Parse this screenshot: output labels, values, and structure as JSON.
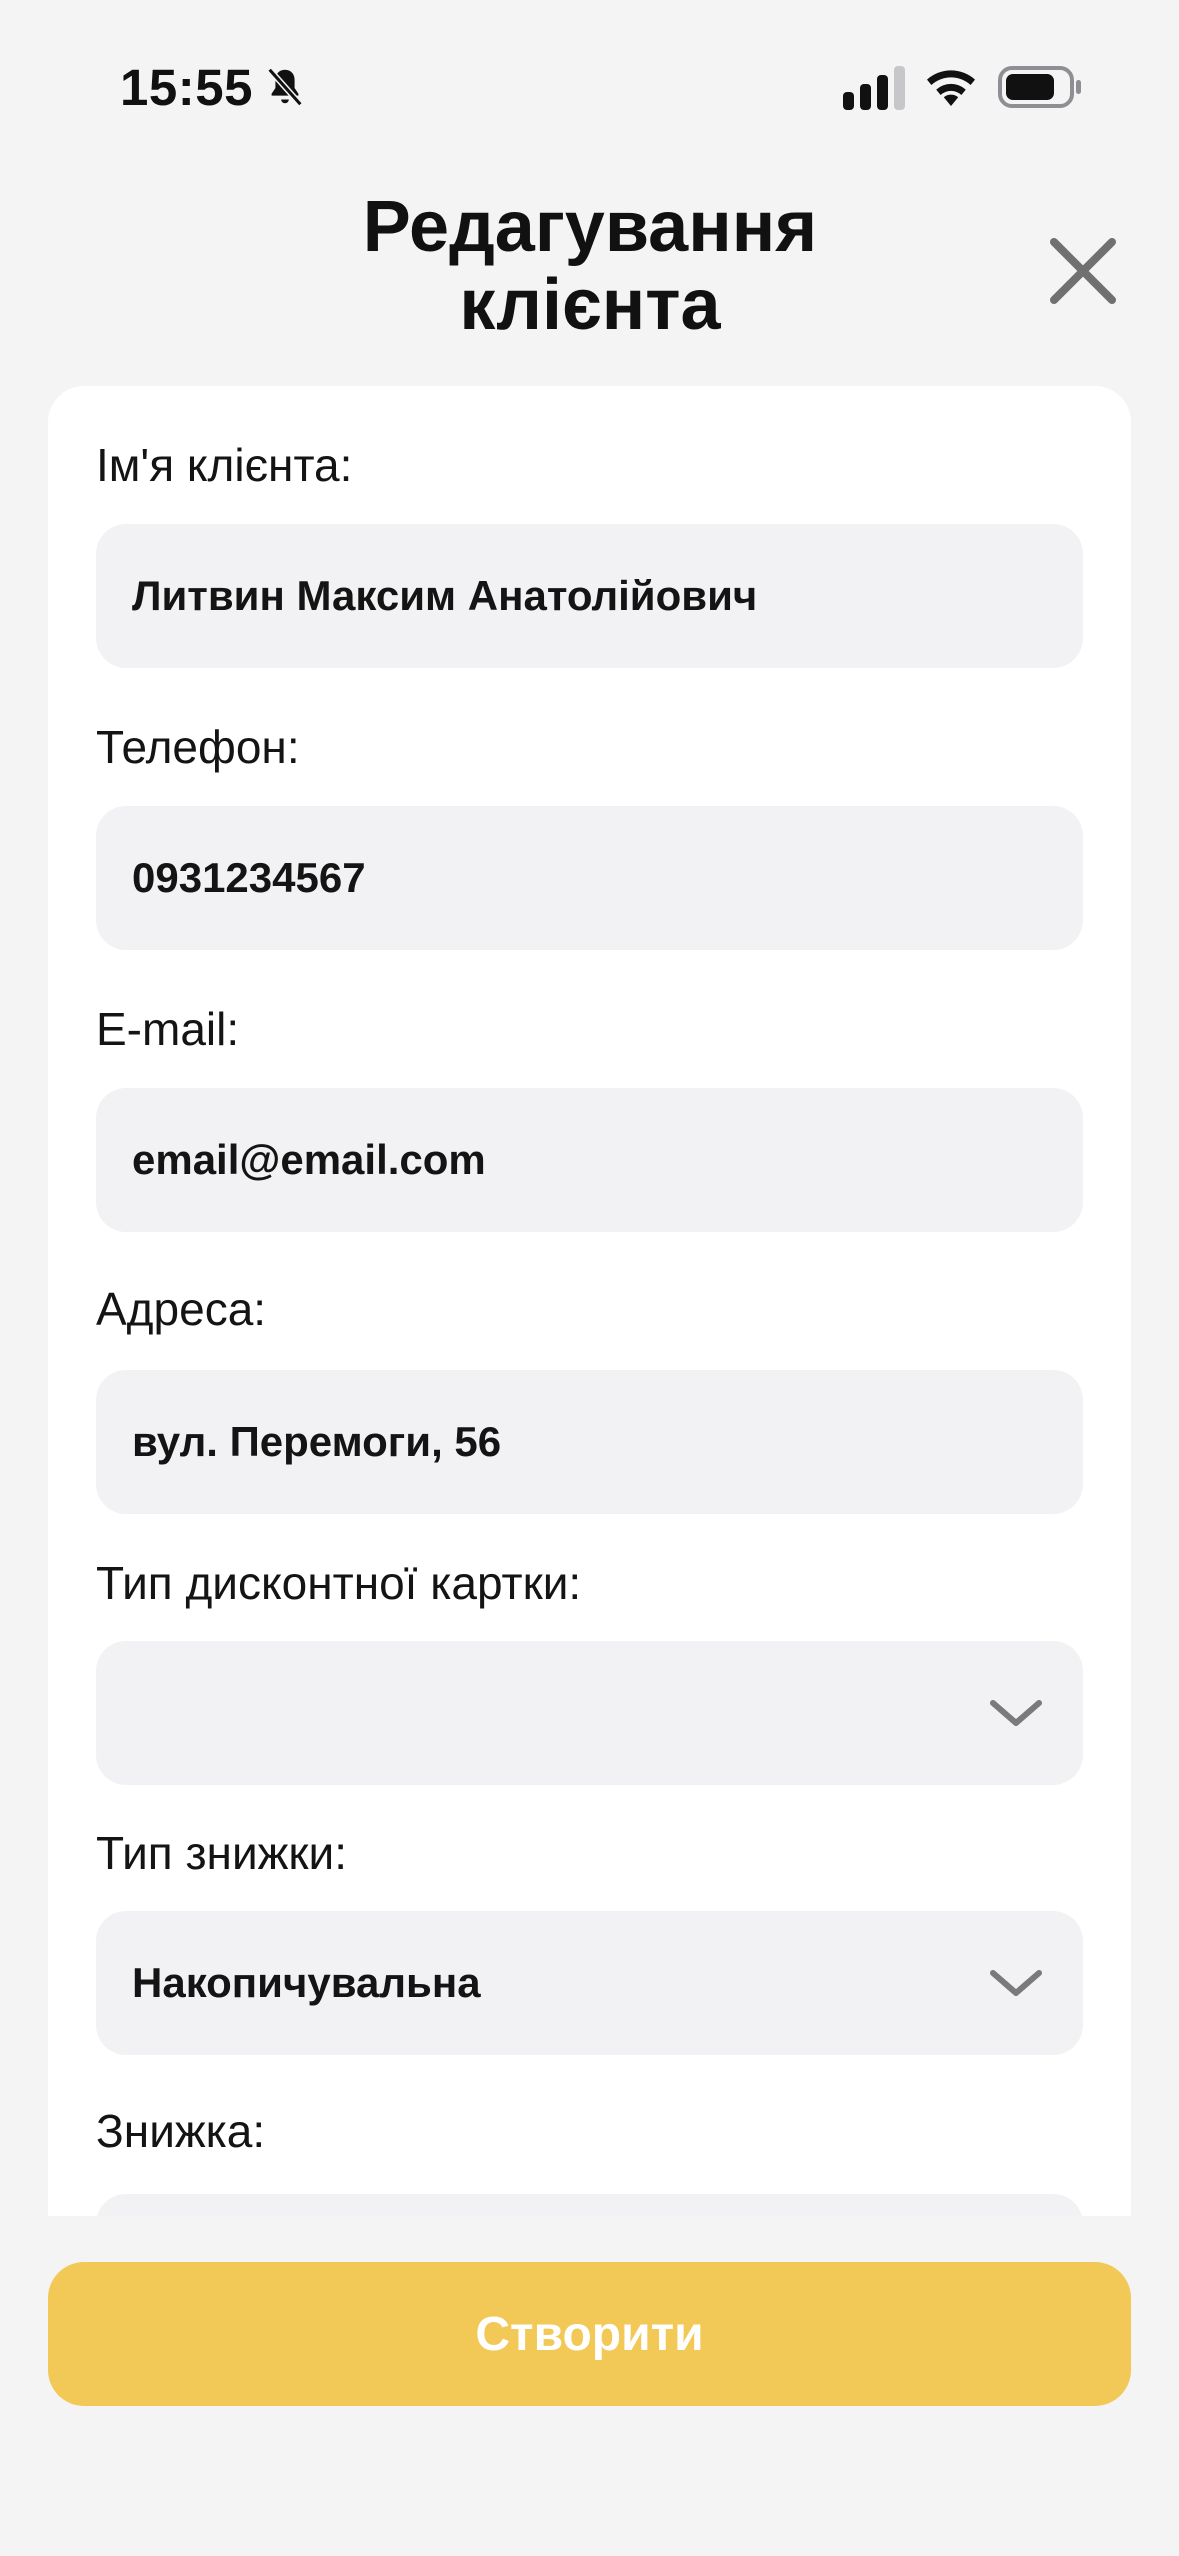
{
  "status_bar": {
    "time": "15:55",
    "icons": [
      "bell-muted-icon",
      "signal-icon",
      "wifi-icon",
      "battery-icon"
    ]
  },
  "header": {
    "title": "Редагування\nклієнта",
    "close_icon": "close-icon"
  },
  "form": {
    "name": {
      "label": "Ім'я клієнта:",
      "value": "Литвин Максим Анатолійович"
    },
    "phone": {
      "label": "Телефон:",
      "value": "0931234567"
    },
    "email": {
      "label": "E-mail:",
      "value": "email@email.com"
    },
    "address": {
      "label": "Адреса:",
      "value": "вул. Перемоги, 56"
    },
    "card_type": {
      "label": "Тип дисконтної картки:",
      "value": ""
    },
    "discount_type": {
      "label": "Тип знижки:",
      "value": "Накопичувальна"
    },
    "discount": {
      "label": "Знижка:",
      "value": ""
    }
  },
  "submit_label": "Створити",
  "colors": {
    "background": "#f4f4f5",
    "card": "#ffffff",
    "input": "#f2f2f4",
    "accent": "#f2c857",
    "icon_gray": "#7a7a7a"
  }
}
